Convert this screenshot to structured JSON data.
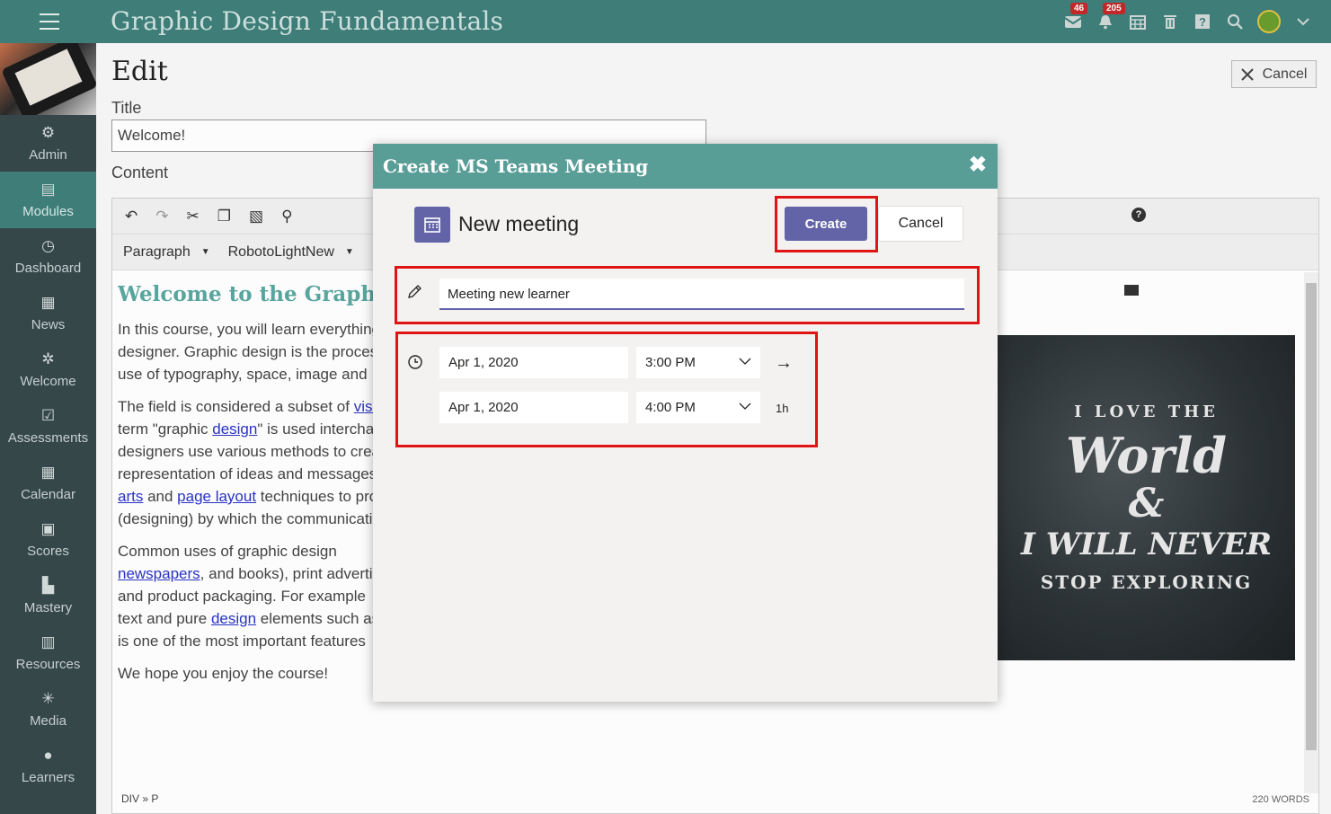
{
  "app": {
    "title": "Graphic Design Fundamentals"
  },
  "header": {
    "icons": [
      {
        "name": "inbox-icon",
        "badge": "46"
      },
      {
        "name": "notifications-icon",
        "badge": "205"
      },
      {
        "name": "calendar-icon"
      },
      {
        "name": "trash-icon"
      },
      {
        "name": "help-icon"
      },
      {
        "name": "search-icon"
      },
      {
        "name": "avatar"
      },
      {
        "name": "chevron-down-icon"
      }
    ]
  },
  "sidebar": {
    "items": [
      {
        "label": "Admin",
        "icon": "gear-icon"
      },
      {
        "label": "Modules",
        "icon": "book-icon",
        "active": true
      },
      {
        "label": "Dashboard",
        "icon": "dashboard-icon"
      },
      {
        "label": "News",
        "icon": "news-icon"
      },
      {
        "label": "Welcome",
        "icon": "sparkle-icon"
      },
      {
        "label": "Assessments",
        "icon": "check-icon"
      },
      {
        "label": "Calendar",
        "icon": "calendar-icon"
      },
      {
        "label": "Scores",
        "icon": "scores-icon"
      },
      {
        "label": "Mastery",
        "icon": "bar-chart-icon"
      },
      {
        "label": "Resources",
        "icon": "library-icon"
      },
      {
        "label": "Media",
        "icon": "spinner-icon"
      },
      {
        "label": "Learners",
        "icon": "person-icon"
      }
    ]
  },
  "page": {
    "heading": "Edit",
    "cancel_label": "Cancel",
    "title_label": "Title",
    "title_value": "Welcome!",
    "content_label": "Content"
  },
  "editor": {
    "format_select": "Paragraph",
    "font_select": "RobotoLightNew",
    "content_heading": "Welcome to the Graphic Design Fundamentals Course",
    "p1": [
      "In this course, you will learn everything",
      "designer. Graphic design is the process",
      "use of typography, space, image and"
    ],
    "p2_l1_text": "The field is considered a subset of ",
    "p2_l1_link": "visual",
    "p2_l2_a": "term \"graphic ",
    "p2_l2_link": "design",
    "p2_l2_b": "\" is used interchangeably",
    "p2_l3": "designers use various methods to create",
    "p2_l4": "representation of ideas and messages",
    "p2_l5_link1": "arts",
    "p2_l5_mid": " and ",
    "p2_l5_link2": "page layout",
    "p2_l5_tail": " techniques to produce",
    "p2_l6": "(designing) by which the communication",
    "p3_l1": "Common uses of graphic design",
    "p3_l2_link": "newspapers",
    "p3_l2_tail": ", and books), print advertising",
    "p3_l3": "and product packaging. For example",
    "p3_l4_a": "text and pure ",
    "p3_l4_link": "design",
    "p3_l4_b": " elements such as",
    "p3_l5": "is one of the most important features",
    "p4": "We hope you enjoy the course!",
    "art_lines": [
      "I LOVE THE",
      "World",
      "&",
      "I WILL NEVER",
      "STOP EXPLORING"
    ],
    "status_path": "DIV » P",
    "word_count": "220 WORDS"
  },
  "modal": {
    "title": "Create MS Teams Meeting",
    "close_glyph": "✖",
    "heading": "New meeting",
    "create_label": "Create",
    "cancel_label": "Cancel",
    "meeting_title": "Meeting new learner",
    "start_date": "Apr 1, 2020",
    "start_time": "3:00 PM",
    "end_date": "Apr 1, 2020",
    "end_time": "4:00 PM",
    "duration": "1h",
    "arrow_glyph": "→"
  }
}
